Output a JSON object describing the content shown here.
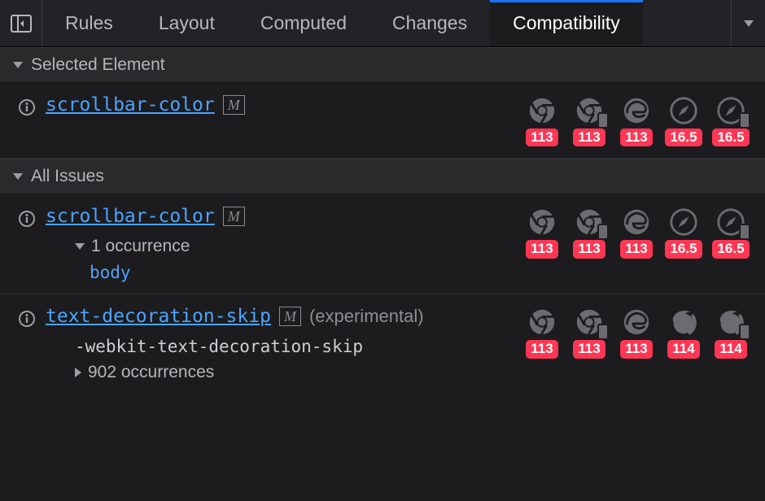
{
  "tabs": {
    "items": [
      "Rules",
      "Layout",
      "Computed",
      "Changes",
      "Compatibility"
    ],
    "active": 4
  },
  "sections": {
    "selected": {
      "title": "Selected Element"
    },
    "all": {
      "title": "All Issues"
    }
  },
  "browsers": {
    "chrome": {
      "name": "chrome"
    },
    "chrome_m": {
      "name": "chrome-mobile",
      "mobile": true
    },
    "edge": {
      "name": "edge"
    },
    "safari": {
      "name": "safari"
    },
    "safari_m": {
      "name": "safari-mobile",
      "mobile": true
    },
    "firefox": {
      "name": "firefox"
    },
    "firefox_m": {
      "name": "firefox-mobile",
      "mobile": true
    }
  },
  "issues": {
    "selected": [
      {
        "property": "scrollbar-color",
        "mdn": "M",
        "support": [
          {
            "browser": "chrome",
            "version": "113"
          },
          {
            "browser": "chrome_m",
            "version": "113"
          },
          {
            "browser": "edge",
            "version": "113"
          },
          {
            "browser": "safari",
            "version": "16.5"
          },
          {
            "browser": "safari_m",
            "version": "16.5"
          }
        ]
      }
    ],
    "all": [
      {
        "property": "scrollbar-color",
        "mdn": "M",
        "expanded": true,
        "occurrence_label": "1 occurrence",
        "selectors": [
          "body"
        ],
        "support": [
          {
            "browser": "chrome",
            "version": "113"
          },
          {
            "browser": "chrome_m",
            "version": "113"
          },
          {
            "browser": "edge",
            "version": "113"
          },
          {
            "browser": "safari",
            "version": "16.5"
          },
          {
            "browser": "safari_m",
            "version": "16.5"
          }
        ]
      },
      {
        "property": "text-decoration-skip",
        "mdn": "M",
        "note": "(experimental)",
        "expanded": false,
        "occurrence_label": "902 occurrences",
        "alias": "-webkit-text-decoration-skip",
        "support": [
          {
            "browser": "chrome",
            "version": "113"
          },
          {
            "browser": "chrome_m",
            "version": "113"
          },
          {
            "browser": "edge",
            "version": "113"
          },
          {
            "browser": "firefox",
            "version": "114"
          },
          {
            "browser": "firefox_m",
            "version": "114"
          }
        ]
      }
    ]
  }
}
